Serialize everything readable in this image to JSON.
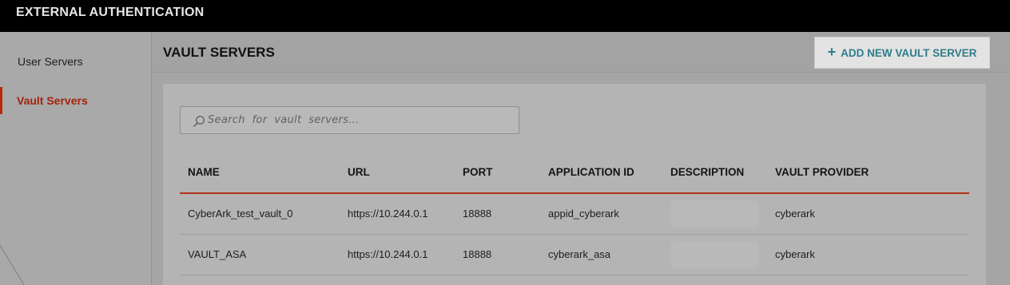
{
  "header": {
    "title": "EXTERNAL AUTHENTICATION"
  },
  "sidebar": {
    "items": [
      {
        "label": "User Servers",
        "active": false
      },
      {
        "label": "Vault Servers",
        "active": true
      }
    ]
  },
  "main": {
    "heading": "VAULT SERVERS",
    "add_button_label": "ADD NEW VAULT SERVER",
    "search": {
      "placeholder": "Search  for  vault  servers..."
    }
  },
  "table": {
    "columns": [
      "NAME",
      "URL",
      "PORT",
      "APPLICATION ID",
      "DESCRIPTION",
      "VAULT PROVIDER"
    ],
    "rows": [
      {
        "name": "CyberArk_test_vault_0",
        "url": "https://10.244.0.1",
        "port": "18888",
        "application_id": "appid_cyberark",
        "provider": "cyberark"
      },
      {
        "name": "VAULT_ASA",
        "url": "https://10.244.0.1",
        "port": "18888",
        "application_id": "cyberark_asa",
        "provider": "cyberark"
      }
    ]
  },
  "colors": {
    "accent": "#b72a10",
    "link": "#2e7d8a",
    "topbar": "#000000"
  }
}
